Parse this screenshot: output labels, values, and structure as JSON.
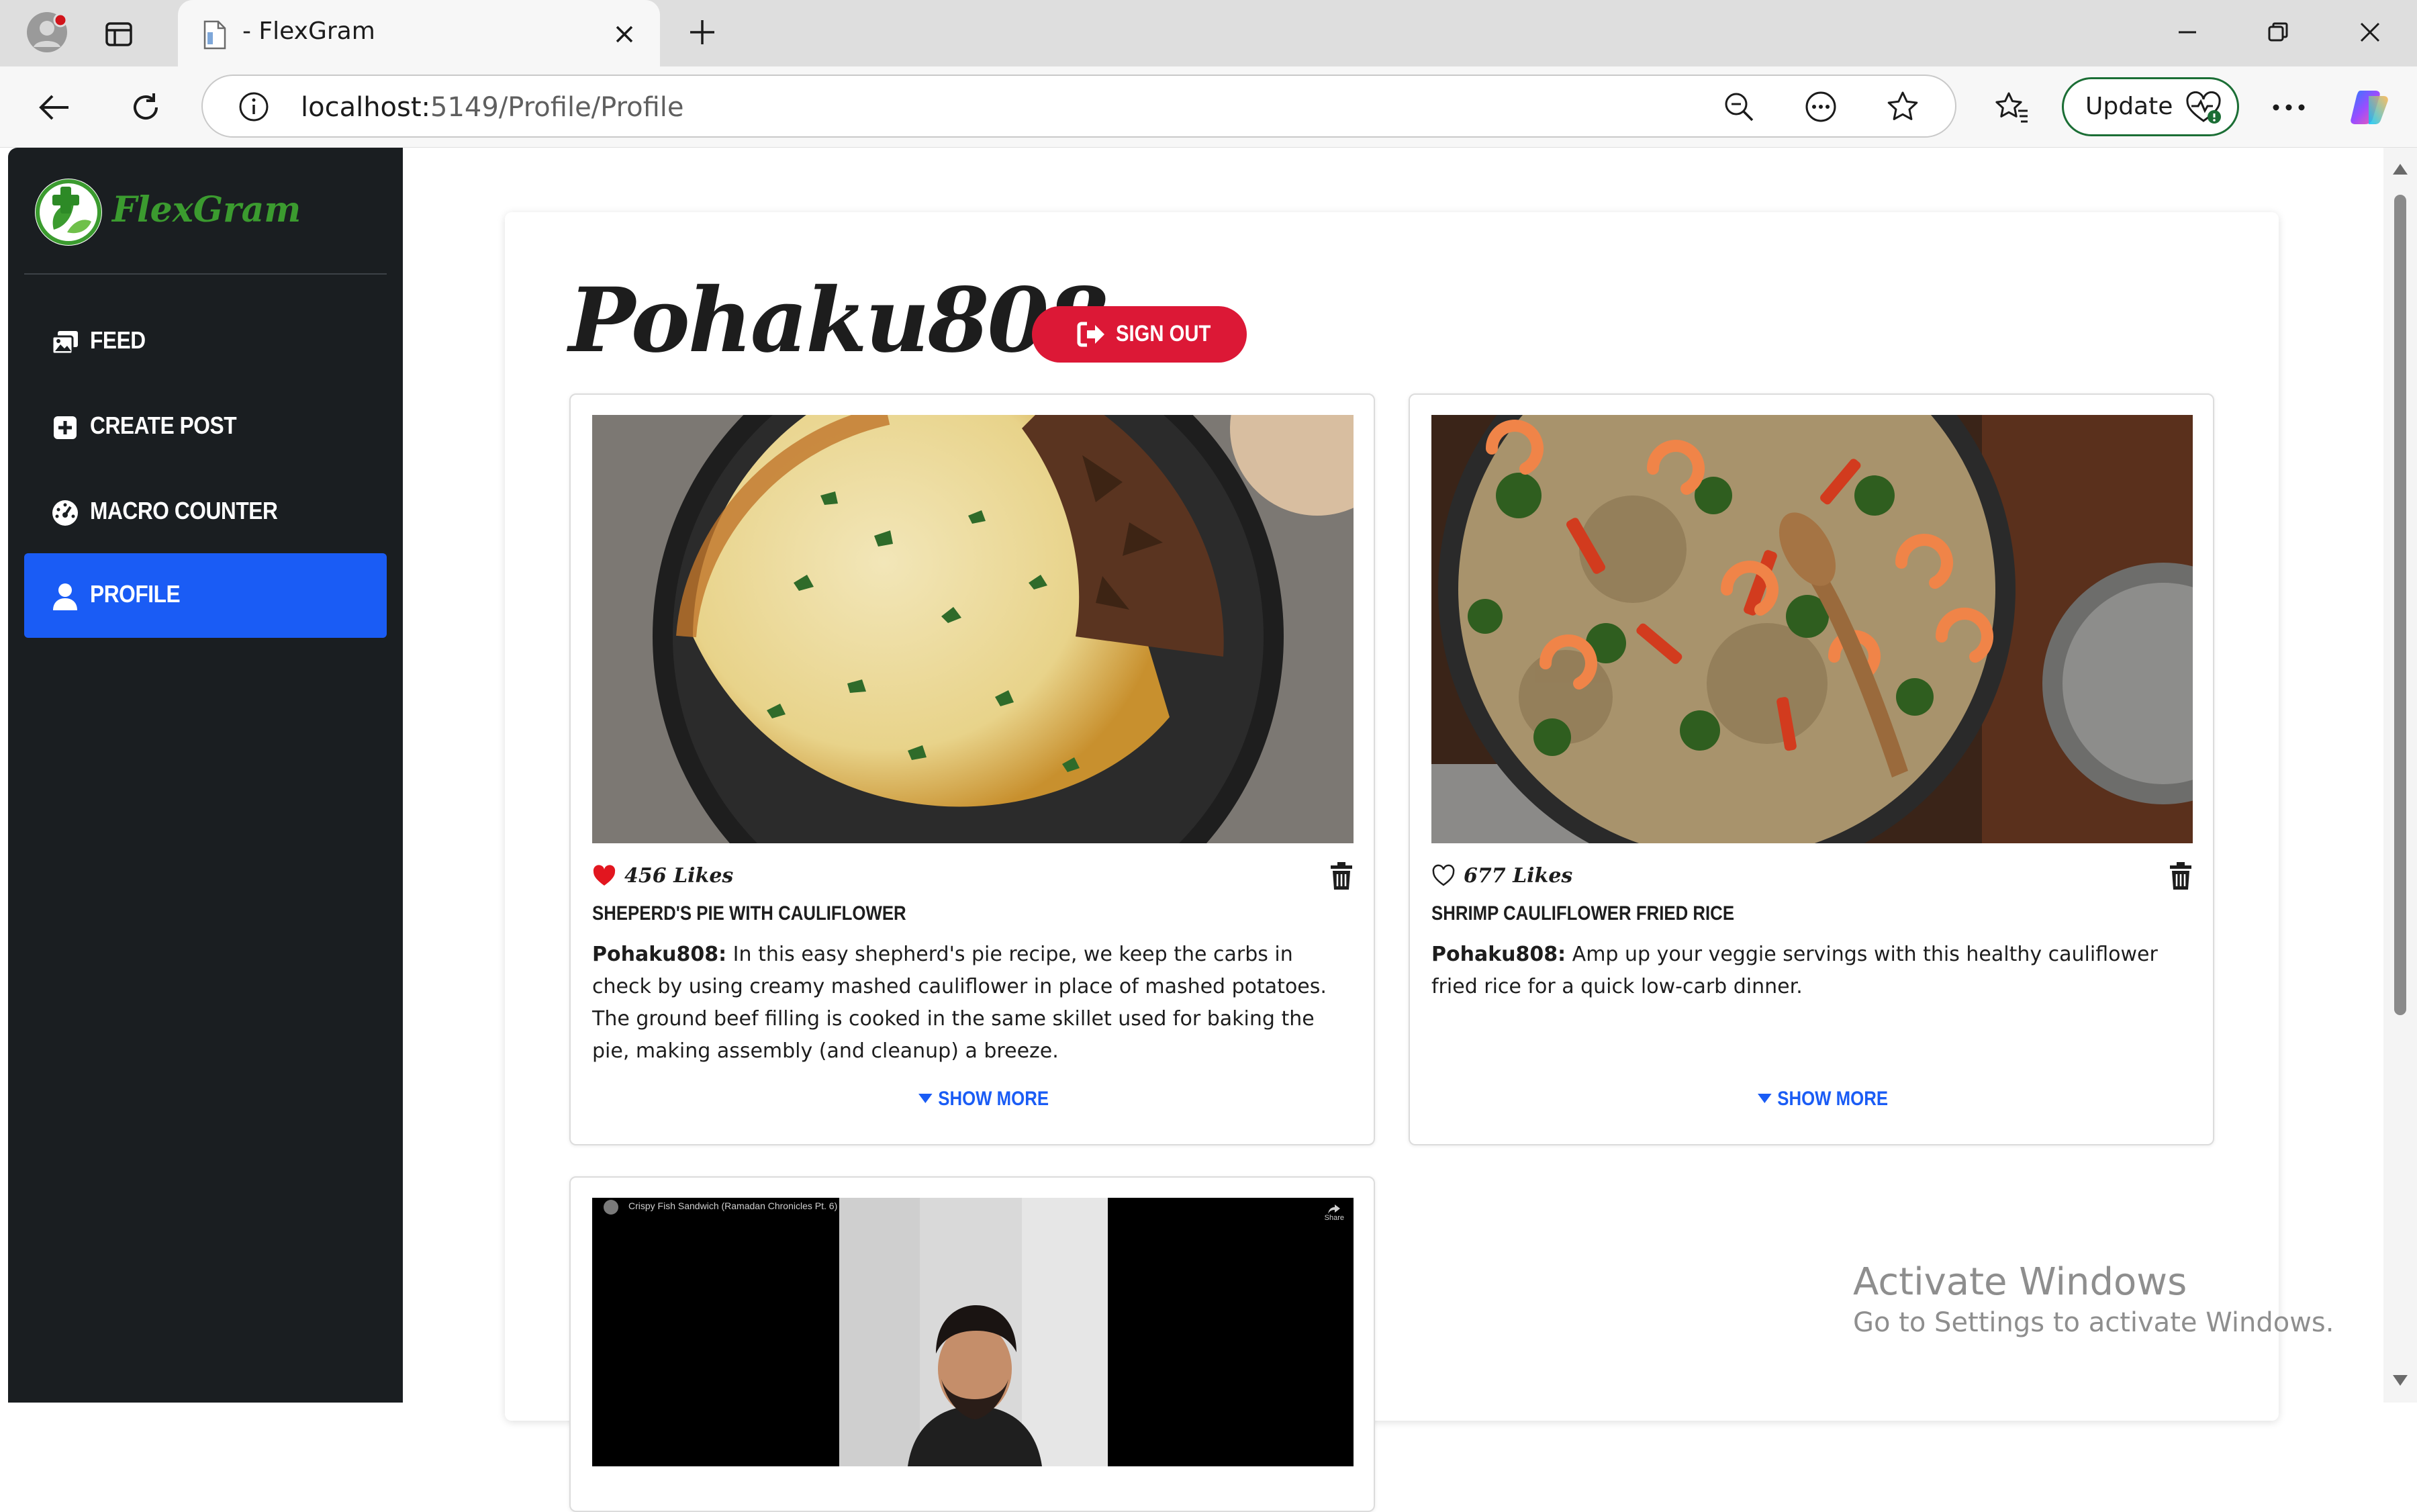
{
  "browser": {
    "tab_title": "- FlexGram",
    "url_host": "localhost:",
    "url_path": "5149/Profile/Profile",
    "update_label": "Update"
  },
  "sidebar": {
    "brand": "FlexGram",
    "items": [
      {
        "label": "FEED",
        "icon": "images-icon",
        "active": false
      },
      {
        "label": "CREATE POST",
        "icon": "plus-square-icon",
        "active": false
      },
      {
        "label": "MACRO COUNTER",
        "icon": "gauge-icon",
        "active": false
      },
      {
        "label": "PROFILE",
        "icon": "user-icon",
        "active": true
      }
    ]
  },
  "profile": {
    "username": "Pohaku808",
    "sign_out_label": "SIGN OUT"
  },
  "posts": [
    {
      "likes": "456 Likes",
      "liked": true,
      "title": "SHEPERD'S PIE WITH CAULIFLOWER",
      "author": "Pohaku808:",
      "body": " In this easy shepherd's pie recipe, we keep the carbs in check by using creamy mashed cauliflower in place of mashed potatoes. The ground beef filling is cooked in the same skillet used for baking the pie, making assembly (and cleanup) a breeze.",
      "show_more": "SHOW MORE"
    },
    {
      "likes": "677 Likes",
      "liked": false,
      "title": "SHRIMP CAULIFLOWER FRIED RICE",
      "author": "Pohaku808:",
      "body": " Amp up your veggie servings with this healthy cauliflower fried rice for a quick low-carb dinner.",
      "show_more": "SHOW MORE"
    }
  ],
  "video_post": {
    "video_title": "Crispy Fish Sandwich (Ramadan Chronicles Pt. 6)",
    "share_label": "Share"
  },
  "watermark": {
    "title": "Activate Windows",
    "subtitle": "Go to Settings to activate Windows."
  },
  "colors": {
    "sidebar_bg": "#1a1e21",
    "accent_blue": "#1a5cf5",
    "sign_out_red": "#dc1836",
    "brand_green": "#3b9b2f"
  }
}
